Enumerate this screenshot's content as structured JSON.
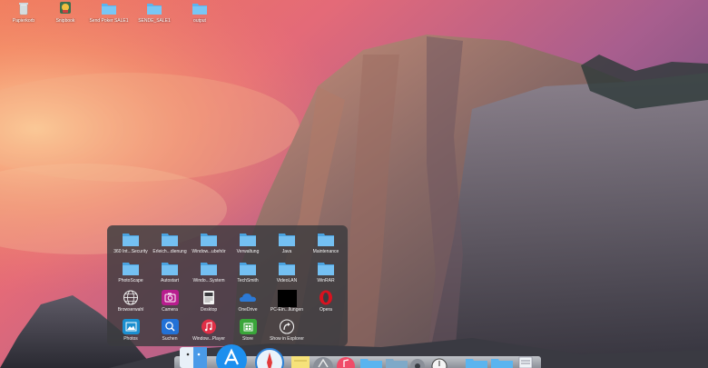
{
  "desktop": {
    "icons": [
      {
        "label": "Papierkorb",
        "icon": "trash-icon"
      },
      {
        "label": "Snipbook",
        "icon": "app-icon"
      },
      {
        "label": "Send Poker SALE1",
        "icon": "folder-icon"
      },
      {
        "label": "SENDE_SALE1",
        "icon": "folder-icon"
      },
      {
        "label": "output",
        "icon": "folder-icon"
      }
    ]
  },
  "launch_folder": {
    "rows": [
      [
        {
          "label": "360 Int...Security",
          "icon": "folder-icon"
        },
        {
          "label": "Erleich...dienung",
          "icon": "folder-icon"
        },
        {
          "label": "Window...ubehör",
          "icon": "folder-icon"
        },
        {
          "label": "Verwaltung",
          "icon": "folder-icon"
        },
        {
          "label": "Java",
          "icon": "folder-icon"
        },
        {
          "label": "Maintenance",
          "icon": "folder-icon"
        }
      ],
      [
        {
          "label": "PhotoScape",
          "icon": "folder-icon"
        },
        {
          "label": "Autostart",
          "icon": "folder-icon"
        },
        {
          "label": "Windo...System",
          "icon": "folder-icon"
        },
        {
          "label": "TechSmith",
          "icon": "folder-icon"
        },
        {
          "label": "VideoLAN",
          "icon": "folder-icon"
        },
        {
          "label": "WinRAR",
          "icon": "folder-icon"
        }
      ],
      [
        {
          "label": "Browserwahl",
          "icon": "globe-icon"
        },
        {
          "label": "Camera",
          "icon": "camera-icon"
        },
        {
          "label": "Desktop",
          "icon": "desktop-icon"
        },
        {
          "label": "OneDrive",
          "icon": "cloud-icon"
        },
        {
          "label": "PC-Ein...llungen",
          "icon": "settings-icon"
        },
        {
          "label": "Opera",
          "icon": "opera-icon"
        }
      ],
      [
        {
          "label": "Photos",
          "icon": "photos-icon"
        },
        {
          "label": "Suchen",
          "icon": "search-icon"
        },
        {
          "label": "Window...Player",
          "icon": "music-icon"
        },
        {
          "label": "Store",
          "icon": "store-icon"
        },
        {
          "label": "Show in Explorer",
          "icon": "arrow-icon"
        }
      ]
    ]
  },
  "dock": {
    "items": [
      "finder-icon",
      "app-store-icon",
      "safari-icon",
      "notes-icon",
      "launchpad-icon",
      "itunes-icon",
      "folder-icon",
      "folder-icon",
      "settings-icon",
      "clock-icon",
      "folder-icon",
      "folder-icon",
      "document-icon"
    ]
  },
  "colors": {
    "panel": "#3a3a3e",
    "folder": "#5ab4ef",
    "camera": "#b81d8e",
    "search": "#2371d6",
    "music": "#e02f46",
    "store": "#3aa63a",
    "photos": "#1b8fd0",
    "opera": "#d8121f"
  }
}
